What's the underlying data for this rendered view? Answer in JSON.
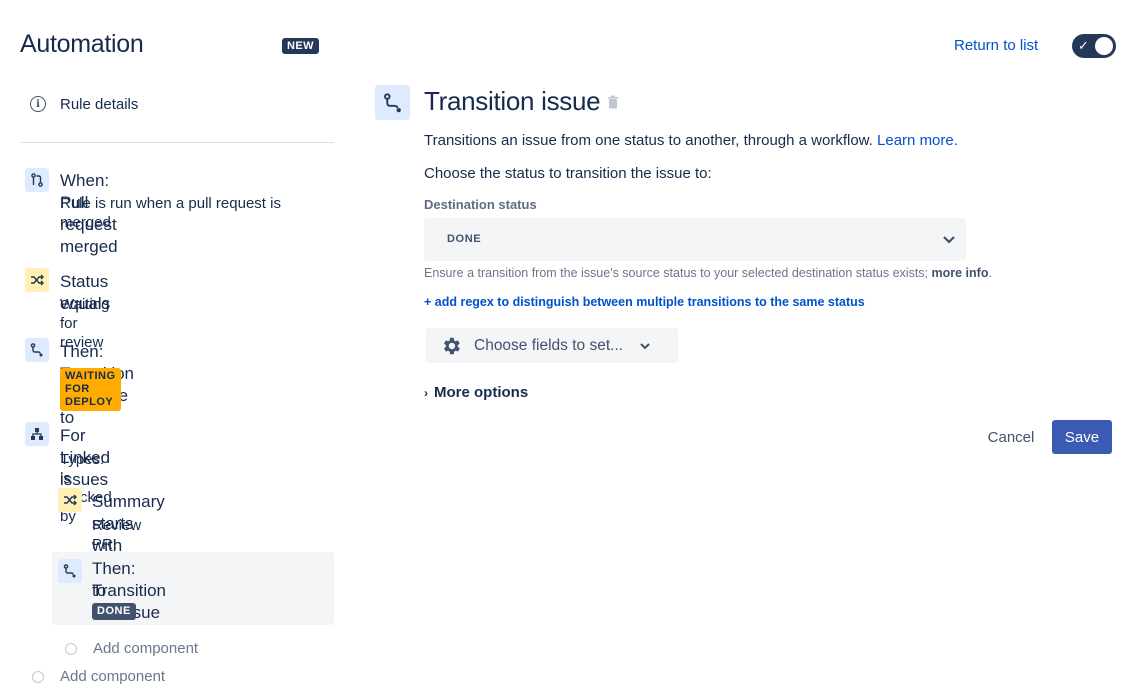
{
  "header": {
    "title": "Automation",
    "badge": "NEW",
    "return_link": "Return to list",
    "toggle_on": true
  },
  "sidebar": {
    "rule_details": "Rule details",
    "components": [
      {
        "icon": "pull-request-icon",
        "title": "When: Pull request merged",
        "subtitle": "Rule is run when a pull request is merged"
      },
      {
        "icon": "condition-icon",
        "title": "Status equals",
        "subtitle": "Waiting for review"
      },
      {
        "icon": "transition-icon",
        "title": "Then: Transition the issue to",
        "lozenge": "WAITING FOR DEPLOY"
      },
      {
        "icon": "branch-icon",
        "title": "For Linked issues",
        "subtitle": "Types: is blocked by"
      },
      {
        "icon": "condition-icon",
        "title": "Summary starts with",
        "subtitle": "Review PR:"
      },
      {
        "icon": "transition-icon",
        "title_line1": "Then: Transition the issue",
        "title_line2": "to",
        "lozenge": "DONE"
      }
    ],
    "add_component_nested": "Add component",
    "add_component": "Add component"
  },
  "main": {
    "title": "Transition issue",
    "description": "Transitions an issue from one status to another, through a workflow.",
    "learn_more": "Learn more.",
    "choose_label": "Choose the status to transition the issue to:",
    "destination_label": "Destination status",
    "destination_value": "DONE",
    "help_text": "Ensure a transition from the issue's source status to your selected destination status exists;",
    "help_link": "more info",
    "help_end": ".",
    "regex_link": "+ add regex to distinguish between multiple transitions to the same status",
    "fields_button": "Choose fields to set...",
    "more_options": "More options",
    "cancel": "Cancel",
    "save": "Save"
  },
  "colors": {
    "accent": "#0052cc",
    "save": "#3b5ab4",
    "toggle": "#253858",
    "lozenge_yellow": "#ffab00",
    "lozenge_dark": "#42526e"
  }
}
